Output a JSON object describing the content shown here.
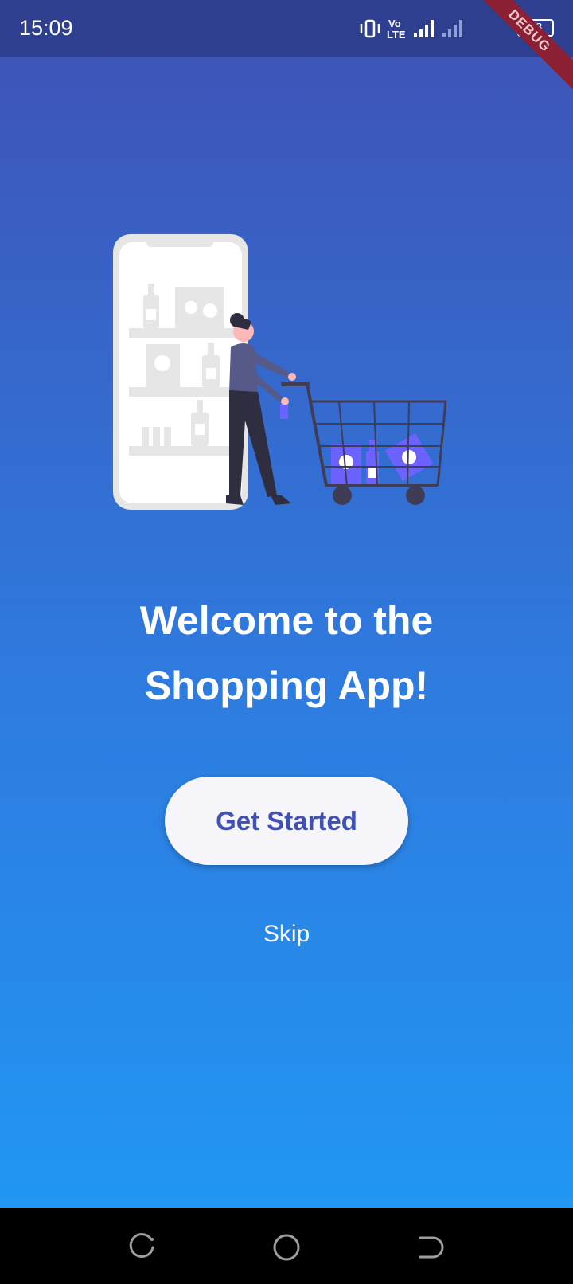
{
  "status_bar": {
    "time": "15:09",
    "network_label": "Vo\nLTE",
    "battery": "48",
    "debug_label": "DEBUG",
    "icons": [
      "vibrate-icon",
      "volte-icon",
      "signal-icon",
      "signal-icon-2",
      "battery-icon"
    ]
  },
  "onboarding": {
    "title_line1": "Welcome to the",
    "title_line2": "Shopping App!",
    "primary_button": "Get Started",
    "secondary_link": "Skip"
  },
  "nav": {
    "icons": [
      "recent-apps-icon",
      "home-icon",
      "back-icon"
    ]
  },
  "colors": {
    "gradient_top": "#3f51b5",
    "gradient_bottom": "#2196f3",
    "accent": "#3f51b5",
    "button_bg": "#f5f5fa",
    "illustration_purple": "#6c63ff"
  }
}
